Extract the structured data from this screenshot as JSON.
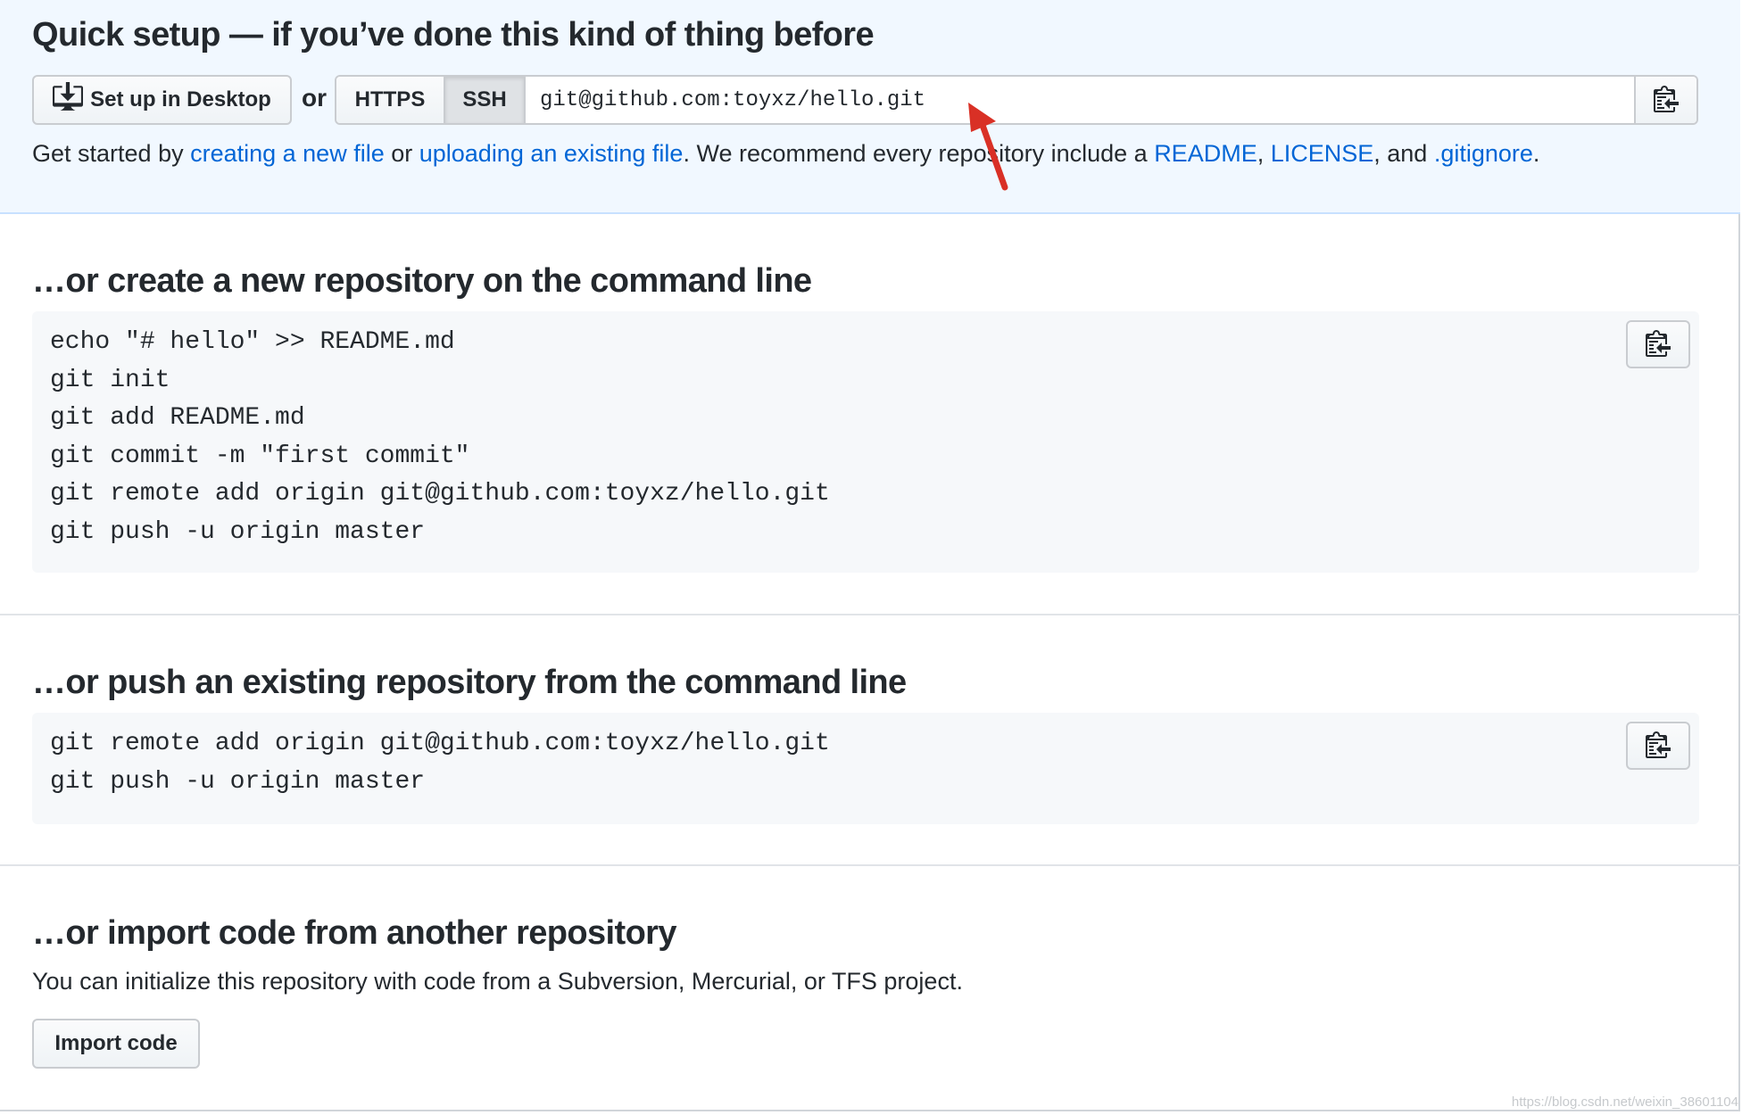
{
  "quick_setup": {
    "heading": "Quick setup — if you’ve done this kind of thing before",
    "desktop_button": "Set up in Desktop",
    "or": "or",
    "protocols": [
      "HTTPS",
      "SSH"
    ],
    "selected_protocol": "SSH",
    "clone_url": "git@github.com:toyxz/hello.git",
    "intro": {
      "t1": "Get started by ",
      "link_new_file": "creating a new file",
      "t2": " or ",
      "link_upload": "uploading an existing file",
      "t3": ". We recommend every repository include a ",
      "link_readme": "README",
      "t4": ", ",
      "link_license": "LICENSE",
      "t5": ", and ",
      "link_gitignore": ".gitignore",
      "t6": "."
    }
  },
  "create_new": {
    "heading": "…or create a new repository on the command line",
    "code": "echo \"# hello\" >> README.md\ngit init\ngit add README.md\ngit commit -m \"first commit\"\ngit remote add origin git@github.com:toyxz/hello.git\ngit push -u origin master"
  },
  "push_existing": {
    "heading": "…or push an existing repository from the command line",
    "code": "git remote add origin git@github.com:toyxz/hello.git\ngit push -u origin master"
  },
  "import": {
    "heading": "…or import code from another repository",
    "description": "You can initialize this repository with code from a Subversion, Mercurial, or TFS project.",
    "button": "Import code"
  },
  "annotation": {
    "arrow_color": "#d93025"
  },
  "watermark": "https://blog.csdn.net/weixin_38601104",
  "colors": {
    "link": "#0366d6",
    "quick_bg": "#f1f8ff",
    "code_bg": "#f6f8fa"
  }
}
